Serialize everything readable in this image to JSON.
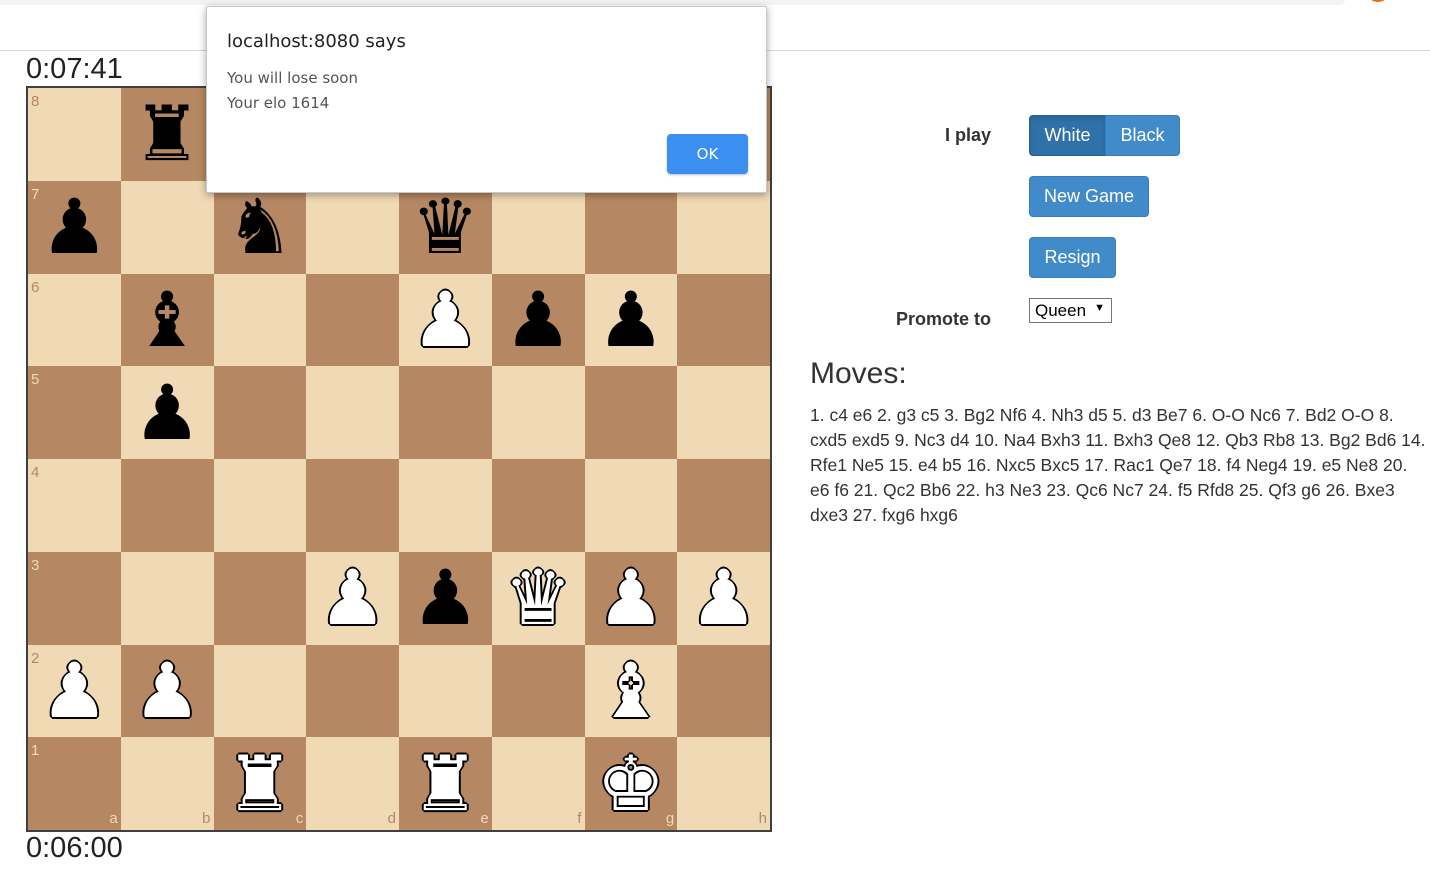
{
  "clocks": {
    "top": "0:07:41",
    "bottom": "0:06:00"
  },
  "board": {
    "files": [
      "a",
      "b",
      "c",
      "d",
      "e",
      "f",
      "g",
      "h"
    ],
    "ranks": [
      "8",
      "7",
      "6",
      "5",
      "4",
      "3",
      "2",
      "1"
    ],
    "pieces": {
      "b8": "bR",
      "a7": "bP",
      "c7": "bN",
      "e7": "bQ",
      "b6": "bB",
      "e6": "wP",
      "f6": "bP",
      "g6": "bP",
      "b5": "bP",
      "d3": "wP",
      "e3": "bP",
      "f3": "wQ",
      "g3": "wP",
      "h3": "wP",
      "a2": "wP",
      "b2": "wP",
      "g2": "wB",
      "c1": "wR",
      "e1": "wR",
      "g1": "wK"
    },
    "colors": {
      "light": "#f0d9b5",
      "dark": "#b58863"
    }
  },
  "controls": {
    "i_play_label": "I play",
    "white_label": "White",
    "black_label": "Black",
    "selected_side": "White",
    "new_game_label": "New Game",
    "resign_label": "Resign",
    "promote_label": "Promote to",
    "promote_value": "Queen"
  },
  "moves": {
    "title": "Moves:",
    "text": "1. c4 e6 2. g3 c5 3. Bg2 Nf6 4. Nh3 d5 5. d3 Be7 6. O-O Nc6 7. Bd2 O-O 8. cxd5 exd5 9. Nc3 d4 10. Na4 Bxh3 11. Bxh3 Qe8 12. Qb3 Rb8 13. Bg2 Bd6 14. Rfe1 Ne5 15. e4 b5 16. Nxc5 Bxc5 17. Rac1 Qe7 18. f4 Neg4 19. e5 Ne8 20. e6 f6 21. Qc2 Bb6 22. h3 Ne3 23. Qc6 Nc7 24. f5 Rfd8 25. Qf3 g6 26. Bxe3 dxe3 27. fxg6 hxg6"
  },
  "dialog": {
    "title": "localhost:8080 says",
    "line1": "You will lose soon",
    "line2": "Your elo 1614",
    "ok_label": "OK"
  },
  "theme": {
    "button_blue": "#428bca",
    "ok_blue": "#3b8ff0"
  }
}
